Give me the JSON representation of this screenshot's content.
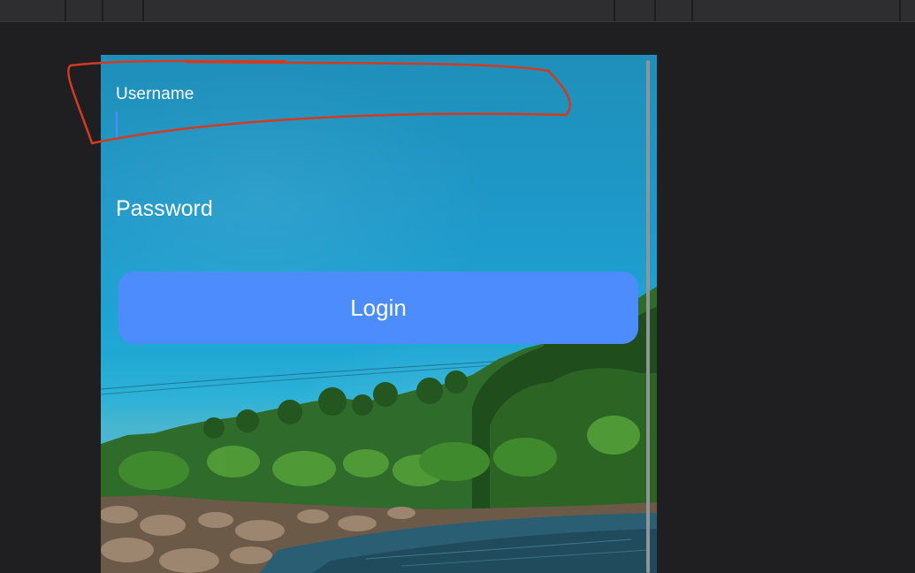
{
  "window": {
    "toolbar_segments": 7
  },
  "form": {
    "username_label": "Username",
    "username_value": "",
    "password_label": "Password",
    "login_label": "Login"
  },
  "colors": {
    "login_button": "#4d8cfd",
    "caret": "#4d8dff",
    "annotation": "#d23a22",
    "sky": "#1e9acb"
  }
}
